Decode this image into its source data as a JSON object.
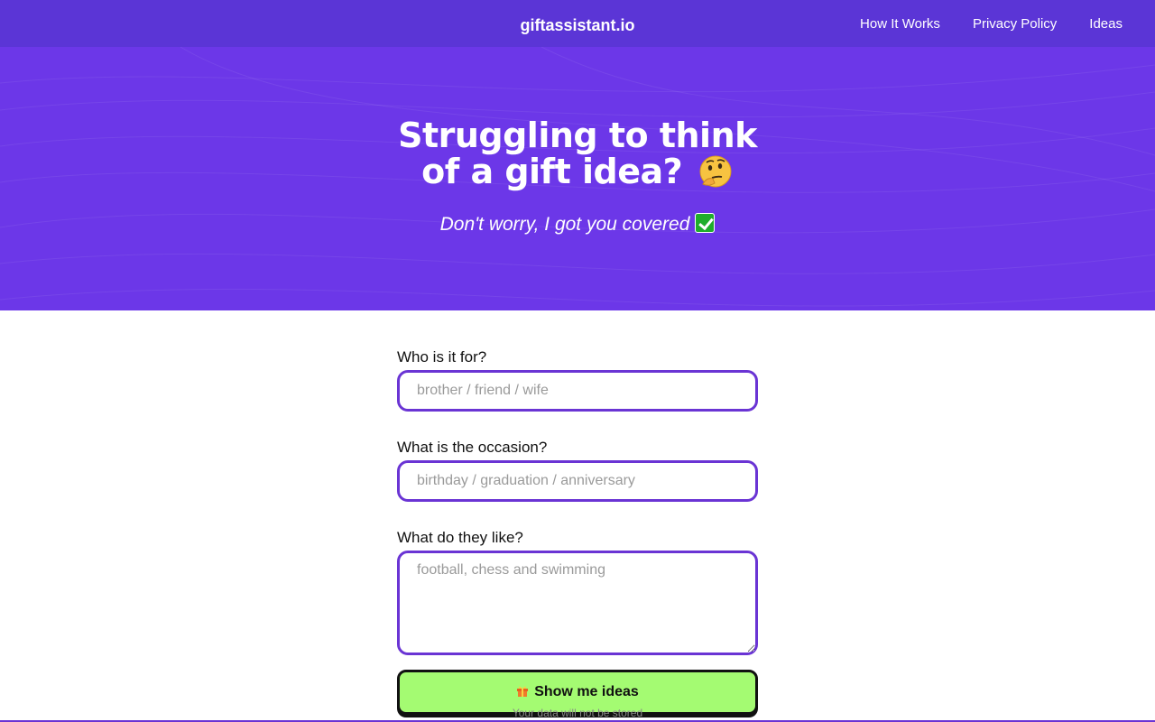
{
  "header": {
    "brand": "giftassistant.io",
    "nav": [
      "How It Works",
      "Privacy Policy",
      "Ideas"
    ]
  },
  "hero": {
    "title_line1": "Struggling to think",
    "title_line2": "of a gift idea?",
    "subtitle": "Don't worry, I got you covered"
  },
  "form": {
    "recipient": {
      "label": "Who is it for?",
      "placeholder": "brother / friend / wife",
      "value": ""
    },
    "occasion": {
      "label": "What is the occasion?",
      "placeholder": "birthday / graduation / anniversary",
      "value": ""
    },
    "likes": {
      "label": "What do they like?",
      "placeholder": "football, chess and swimming",
      "value": ""
    },
    "submit_label": "Show me ideas",
    "privacy_note": "Your data will not be stored"
  },
  "icons": {
    "thinking": "thinking-face-emoji",
    "check": "check-mark-emoji",
    "gift": "gift-emoji"
  },
  "colors": {
    "header_bg": "#5b35d6",
    "hero_bg": "#6c37e8",
    "input_border": "#6a34d4",
    "button_bg": "#a4fb72"
  }
}
